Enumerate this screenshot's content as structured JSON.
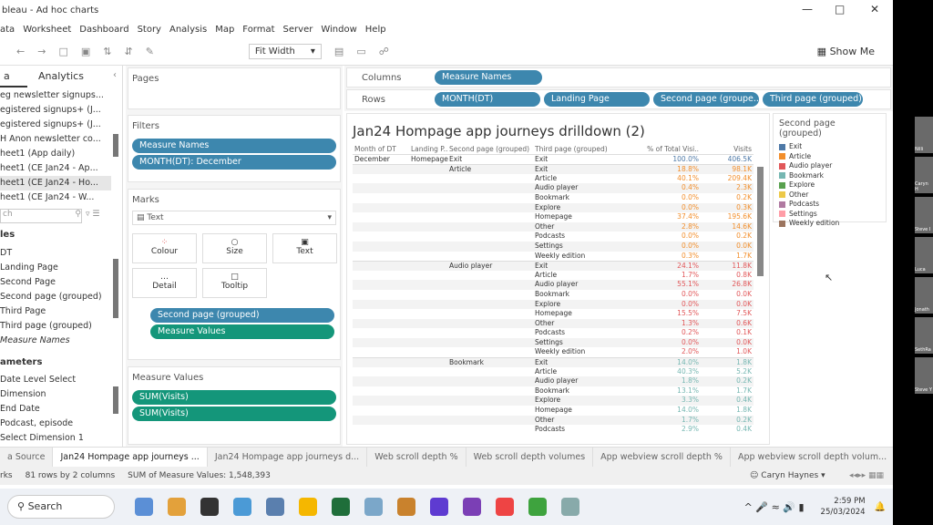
{
  "window": {
    "title": "bleau - Ad hoc charts"
  },
  "menu": [
    "ata",
    "Worksheet",
    "Dashboard",
    "Story",
    "Analysis",
    "Map",
    "Format",
    "Server",
    "Window",
    "Help"
  ],
  "toolbar": {
    "fit": "Fit Width",
    "show_me": "Show Me"
  },
  "left": {
    "tab_data": "a",
    "tab_analytics": "Analytics",
    "sources": [
      "eg newsletter signups...",
      "egistered signups+ (J...",
      "egistered signups+ (J...",
      "H Anon newsletter co...",
      "heet1 (App daily)",
      "heet1 (CE Jan24 - Ap...",
      "heet1 (CE Jan24 - Ho...",
      "heet1 (CE Jan24 - W..."
    ],
    "search_placeholder": "ch",
    "tables_header": "les",
    "fields": [
      "DT",
      "Landing Page",
      "Second Page",
      "Second page (grouped)",
      "Third Page",
      "Third page (grouped)",
      "Measure Names"
    ],
    "parameters_header": "ameters",
    "parameters": [
      "Date Level Select",
      "Dimension",
      "End Date",
      "Podcast, episode",
      "Select Dimension 1"
    ]
  },
  "shelves": {
    "pages": "Pages",
    "filters": "Filters",
    "filter_pills": [
      "Measure Names",
      "MONTH(DT): December"
    ],
    "marks": "Marks",
    "mark_type": "Text",
    "mark_buttons": [
      "Colour",
      "Size",
      "Text",
      "Detail",
      "Tooltip"
    ],
    "mark_pills": [
      "Second page (grouped)",
      "Measure Values"
    ],
    "measure_values": "Measure Values",
    "mv_pills": [
      "SUM(Visits)",
      "SUM(Visits)"
    ],
    "columns": "Columns",
    "column_pills": [
      "Measure Names"
    ],
    "rows": "Rows",
    "row_pills": [
      "MONTH(DT)",
      "Landing Page",
      "Second page (groupe..",
      "Third page (grouped)"
    ]
  },
  "viz": {
    "title": "Jan24 Hompage app journeys drilldown (2)",
    "headers": [
      "Month of DT",
      "Landing P..",
      "Second page (grouped)",
      "Third page (grouped)",
      "% of Total Visi..",
      "Visits"
    ],
    "rows": [
      [
        "December",
        "Homepage",
        "Exit",
        "Exit",
        "100.0%",
        "406.5K"
      ],
      [
        "",
        "",
        "Article",
        "Exit",
        "18.8%",
        "98.1K"
      ],
      [
        "",
        "",
        "",
        "Article",
        "40.1%",
        "209.4K"
      ],
      [
        "",
        "",
        "",
        "Audio player",
        "0.4%",
        "2.3K"
      ],
      [
        "",
        "",
        "",
        "Bookmark",
        "0.0%",
        "0.2K"
      ],
      [
        "",
        "",
        "",
        "Explore",
        "0.0%",
        "0.3K"
      ],
      [
        "",
        "",
        "",
        "Homepage",
        "37.4%",
        "195.6K"
      ],
      [
        "",
        "",
        "",
        "Other",
        "2.8%",
        "14.6K"
      ],
      [
        "",
        "",
        "",
        "Podcasts",
        "0.0%",
        "0.2K"
      ],
      [
        "",
        "",
        "",
        "Settings",
        "0.0%",
        "0.0K"
      ],
      [
        "",
        "",
        "",
        "Weekly edition",
        "0.3%",
        "1.7K"
      ],
      [
        "",
        "",
        "Audio player",
        "Exit",
        "24.1%",
        "11.8K"
      ],
      [
        "",
        "",
        "",
        "Article",
        "1.7%",
        "0.8K"
      ],
      [
        "",
        "",
        "",
        "Audio player",
        "55.1%",
        "26.8K"
      ],
      [
        "",
        "",
        "",
        "Bookmark",
        "0.0%",
        "0.0K"
      ],
      [
        "",
        "",
        "",
        "Explore",
        "0.0%",
        "0.0K"
      ],
      [
        "",
        "",
        "",
        "Homepage",
        "15.5%",
        "7.5K"
      ],
      [
        "",
        "",
        "",
        "Other",
        "1.3%",
        "0.6K"
      ],
      [
        "",
        "",
        "",
        "Podcasts",
        "0.2%",
        "0.1K"
      ],
      [
        "",
        "",
        "",
        "Settings",
        "0.0%",
        "0.0K"
      ],
      [
        "",
        "",
        "",
        "Weekly edition",
        "2.0%",
        "1.0K"
      ],
      [
        "",
        "",
        "Bookmark",
        "Exit",
        "14.0%",
        "1.8K"
      ],
      [
        "",
        "",
        "",
        "Article",
        "40.3%",
        "5.2K"
      ],
      [
        "",
        "",
        "",
        "Audio player",
        "1.8%",
        "0.2K"
      ],
      [
        "",
        "",
        "",
        "Bookmark",
        "13.1%",
        "1.7K"
      ],
      [
        "",
        "",
        "",
        "Explore",
        "3.3%",
        "0.4K"
      ],
      [
        "",
        "",
        "",
        "Homepage",
        "14.0%",
        "1.8K"
      ],
      [
        "",
        "",
        "",
        "Other",
        "1.7%",
        "0.2K"
      ],
      [
        "",
        "",
        "",
        "Podcasts",
        "2.9%",
        "0.4K"
      ]
    ]
  },
  "legend": {
    "title": "Second page (grouped)",
    "items": [
      {
        "label": "Exit",
        "color": "#4e79a7"
      },
      {
        "label": "Article",
        "color": "#f28e2b"
      },
      {
        "label": "Audio player",
        "color": "#e15759"
      },
      {
        "label": "Bookmark",
        "color": "#76b7b2"
      },
      {
        "label": "Explore",
        "color": "#59a14f"
      },
      {
        "label": "Other",
        "color": "#edc948"
      },
      {
        "label": "Podcasts",
        "color": "#b07aa1"
      },
      {
        "label": "Settings",
        "color": "#ff9da7"
      },
      {
        "label": "Weekly edition",
        "color": "#9c755f"
      }
    ]
  },
  "sheet_tabs": [
    "a Source",
    "Jan24 Hompage app journeys ...",
    "Jan24 Hompage app journeys d...",
    "Web scroll depth %",
    "Web scroll depth volumes",
    "App webview scroll depth %",
    "App webview scroll depth volum..."
  ],
  "status": {
    "marks": "rks",
    "rows": "81 rows by 2 columns",
    "sum": "SUM of Measure Values: 1,548,393",
    "user": "Caryn Haynes"
  },
  "taskbar": {
    "search": "Search",
    "time": "2:59 PM",
    "date": "25/03/2024",
    "icons": [
      "copilot",
      "files",
      "notifications",
      "calculator",
      "file-explorer",
      "app",
      "monitor",
      "snipping",
      "slack",
      "github",
      "chrome",
      "app-circle",
      "tableau",
      "zoom"
    ]
  },
  "zoom_participants": [
    "Nilli",
    "Caryn H",
    "Steve I",
    "Luca",
    "Jonath",
    "SethRa",
    "Steve Y"
  ]
}
